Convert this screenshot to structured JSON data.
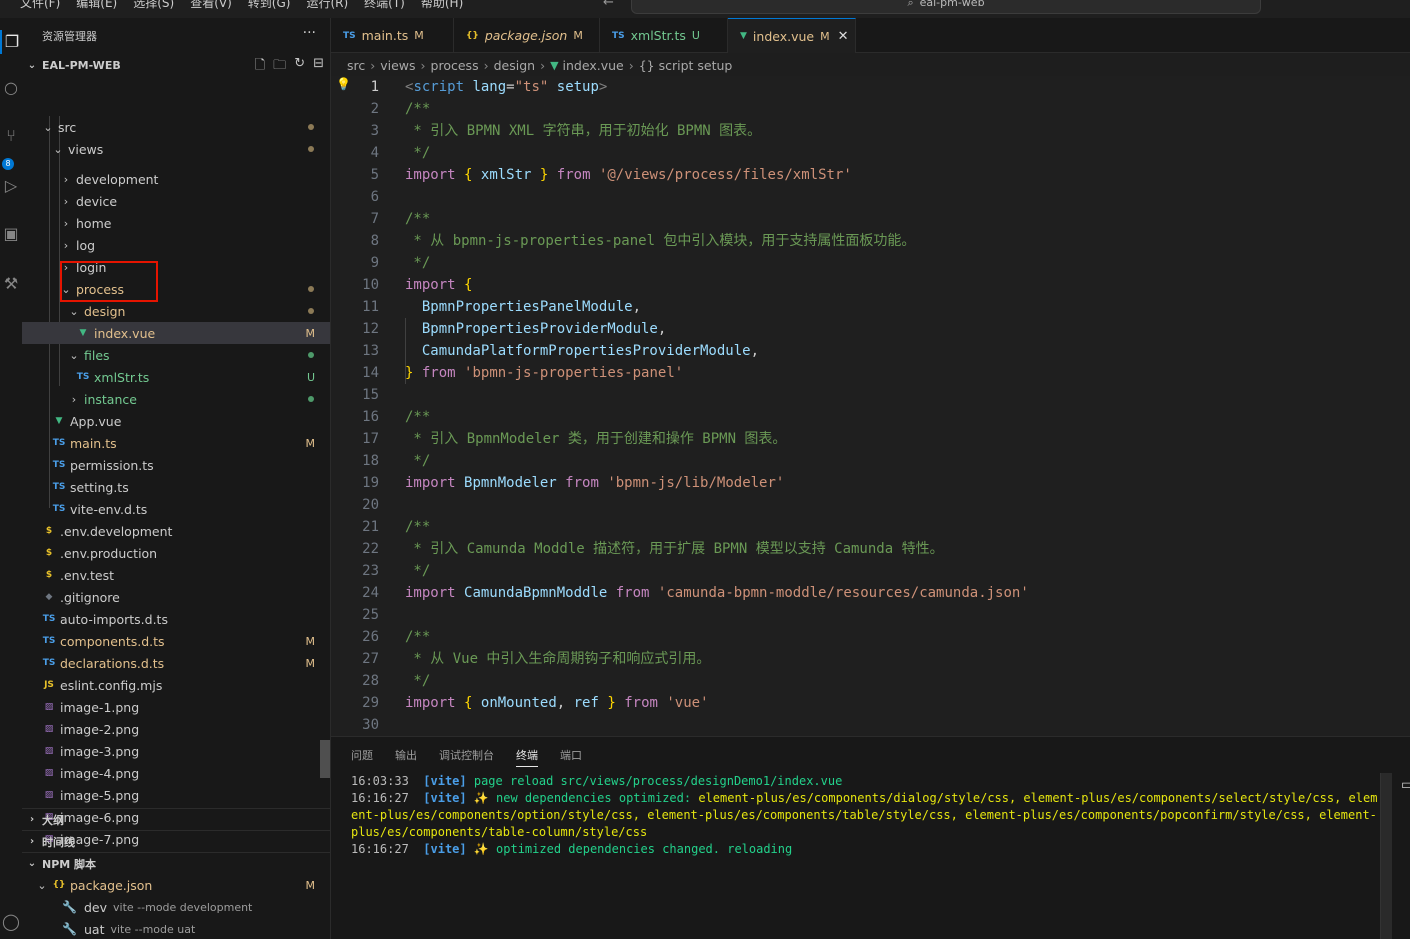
{
  "menu": [
    "文件(F)",
    "编辑(E)",
    "选择(S)",
    "查看(V)",
    "转到(G)",
    "运行(R)",
    "终端(T)",
    "帮助(H)"
  ],
  "nav_arrows": "← →",
  "command_center": "eal-pm-web",
  "activity_badge": "8",
  "explorer": {
    "title": "资源管理器",
    "more": "···",
    "project": "EAL-PM-WEB",
    "tools": [
      "new-file-icon",
      "new-folder-icon",
      "refresh-icon",
      "collapse-icon"
    ],
    "rows": [
      {
        "label": "src",
        "chev": "⌄",
        "indent": 20,
        "color": "#cccccc",
        "status": "dot"
      },
      {
        "label": "views",
        "chev": "⌄",
        "indent": 30,
        "color": "#cccccc",
        "status": "dot"
      },
      {
        "label": "development",
        "chev": "›",
        "indent": 38,
        "color": "#cccccc"
      },
      {
        "label": "device",
        "chev": "›",
        "indent": 38,
        "color": "#cccccc"
      },
      {
        "label": "home",
        "chev": "›",
        "indent": 38,
        "color": "#cccccc"
      },
      {
        "label": "log",
        "chev": "›",
        "indent": 38,
        "color": "#cccccc"
      },
      {
        "label": "login",
        "chev": "›",
        "indent": 38,
        "color": "#cccccc"
      },
      {
        "label": "process",
        "chev": "⌄",
        "indent": 38,
        "color": "#e2c08d",
        "status": "dot"
      },
      {
        "label": "design",
        "chev": "⌄",
        "indent": 46,
        "color": "#e2c08d",
        "status": "dot"
      },
      {
        "label": "index.vue",
        "icon": "vue",
        "indent": 54,
        "color": "#e2c08d",
        "status": "M",
        "selected": true
      },
      {
        "label": "files",
        "chev": "⌄",
        "indent": 46,
        "color": "#73c991",
        "status": "dotgreen"
      },
      {
        "label": "xmlStr.ts",
        "icon": "ts",
        "indent": 54,
        "color": "#73c991",
        "status": "U"
      },
      {
        "label": "instance",
        "chev": "›",
        "indent": 46,
        "color": "#73c991",
        "status": "dotgreen"
      },
      {
        "label": "App.vue",
        "icon": "vue",
        "indent": 30,
        "color": "#cccccc"
      },
      {
        "label": "main.ts",
        "icon": "ts",
        "indent": 30,
        "color": "#e2c08d",
        "status": "M"
      },
      {
        "label": "permission.ts",
        "icon": "ts",
        "indent": 30,
        "color": "#cccccc"
      },
      {
        "label": "setting.ts",
        "icon": "ts",
        "indent": 30,
        "color": "#cccccc"
      },
      {
        "label": "vite-env.d.ts",
        "icon": "ts",
        "indent": 30,
        "color": "#cccccc"
      },
      {
        "label": ".env.development",
        "icon": "env",
        "indent": 20,
        "color": "#cccccc"
      },
      {
        "label": ".env.production",
        "icon": "env",
        "indent": 20,
        "color": "#cccccc"
      },
      {
        "label": ".env.test",
        "icon": "env",
        "indent": 20,
        "color": "#cccccc"
      },
      {
        "label": ".gitignore",
        "icon": "git",
        "indent": 20,
        "color": "#cccccc"
      },
      {
        "label": "auto-imports.d.ts",
        "icon": "ts",
        "indent": 20,
        "color": "#cccccc"
      },
      {
        "label": "components.d.ts",
        "icon": "ts",
        "indent": 20,
        "color": "#e2c08d",
        "status": "M"
      },
      {
        "label": "declarations.d.ts",
        "icon": "ts",
        "indent": 20,
        "color": "#e2c08d",
        "status": "M"
      },
      {
        "label": "eslint.config.mjs",
        "icon": "js",
        "indent": 20,
        "color": "#cccccc"
      },
      {
        "label": "image-1.png",
        "icon": "img",
        "indent": 20,
        "color": "#cccccc"
      },
      {
        "label": "image-2.png",
        "icon": "img",
        "indent": 20,
        "color": "#cccccc"
      },
      {
        "label": "image-3.png",
        "icon": "img",
        "indent": 20,
        "color": "#cccccc"
      },
      {
        "label": "image-4.png",
        "icon": "img",
        "indent": 20,
        "color": "#cccccc"
      },
      {
        "label": "image-5.png",
        "icon": "img",
        "indent": 20,
        "color": "#cccccc"
      },
      {
        "label": "image-6.png",
        "icon": "img",
        "indent": 20,
        "color": "#cccccc"
      },
      {
        "label": "image-7.png",
        "icon": "img",
        "indent": 20,
        "color": "#cccccc"
      }
    ],
    "outline": "大纲",
    "timeline": "时间线",
    "npm_title": "NPM 脚本",
    "npm_package": "package.json",
    "npm_package_status": "M",
    "npm_scripts": [
      {
        "name": "dev",
        "cmd": "vite --mode development"
      },
      {
        "name": "uat",
        "cmd": "vite --mode uat"
      }
    ]
  },
  "tabs": [
    {
      "icon": "TS",
      "label": "main.ts",
      "status": "M",
      "color": "#e2c08d"
    },
    {
      "icon": "{}",
      "label": "package.json",
      "status": "M",
      "color": "#e2c08d",
      "italic": true
    },
    {
      "icon": "TS",
      "label": "xmlStr.ts",
      "status": "U",
      "color": "#73c991"
    },
    {
      "icon": "V",
      "label": "index.vue",
      "status": "M",
      "color": "#e2c08d",
      "active": true
    }
  ],
  "tab_close": "✕",
  "breadcrumb": [
    "src",
    "views",
    "process",
    "design",
    "index.vue",
    "{} script setup"
  ],
  "code_lines": [
    "<span class='pun'>&lt;</span><span class='tag'>script</span> <span class='attr'>lang</span>=<span class='str'>\"ts\"</span> <span class='attr'>setup</span><span class='pun'>&gt;</span>",
    "<span class='cm'>/**</span>",
    "<span class='cm'> * 引入 BPMN XML 字符串，用于初始化 BPMN 图表。</span>",
    "<span class='cm'> */</span>",
    "<span class='kw2'>import</span> <span class='br'>{</span> <span class='id'>xmlStr</span> <span class='br'>}</span> <span class='kw2'>from</span> <span class='str'>'@/views/process/files/xmlStr'</span>",
    "",
    "<span class='cm'>/**</span>",
    "<span class='cm'> * 从 bpmn-js-properties-panel 包中引入模块，用于支持属性面板功能。</span>",
    "<span class='cm'> */</span>",
    "<span class='kw2'>import</span> <span class='br'>{</span>",
    "  <span class='id'>BpmnPropertiesPanelModule</span>,",
    "  <span class='id'>BpmnPropertiesProviderModule</span>,",
    "  <span class='id'>CamundaPlatformPropertiesProviderModule</span>,",
    "<span class='br'>}</span> <span class='kw2'>from</span> <span class='str'>'bpmn-js-properties-panel'</span>",
    "",
    "<span class='cm'>/**</span>",
    "<span class='cm'> * 引入 BpmnModeler 类，用于创建和操作 BPMN 图表。</span>",
    "<span class='cm'> */</span>",
    "<span class='kw2'>import</span> <span class='id'>BpmnModeler</span> <span class='kw2'>from</span> <span class='str'>'bpmn-js/lib/Modeler'</span>",
    "",
    "<span class='cm'>/**</span>",
    "<span class='cm'> * 引入 Camunda Moddle 描述符，用于扩展 BPMN 模型以支持 Camunda 特性。</span>",
    "<span class='cm'> */</span>",
    "<span class='kw2'>import</span> <span class='id'>CamundaBpmnModdle</span> <span class='kw2'>from</span> <span class='str'>'camunda-bpmn-moddle/resources/camunda.json'</span>",
    "",
    "<span class='cm'>/**</span>",
    "<span class='cm'> * 从 Vue 中引入生命周期钩子和响应式引用。</span>",
    "<span class='cm'> */</span>",
    "<span class='kw2'>import</span> <span class='br'>{</span> <span class='id'>onMounted</span>, <span class='id'>ref</span> <span class='br'>}</span> <span class='kw2'>from</span> <span class='str'>'vue'</span>",
    ""
  ],
  "panel_tabs": [
    "问题",
    "输出",
    "调试控制台",
    "终端",
    "端口"
  ],
  "panel_active": "终端",
  "terminal": [
    {
      "time": "16:03:33",
      "tag": "[vite]",
      "text": "page reload src/views/process/designDemo1/index.vue",
      "cls": "green"
    },
    {
      "time": "16:16:27",
      "tag": "[vite]",
      "text": "✨ new dependencies optimized: ",
      "cls": "green",
      "extra": "element-plus/es/components/dialog/style/css, element-plus/es/components/select/style/css, element-plus/es/components/option/style/css, element-plus/es/components/table/style/css, element-plus/es/components/popconfirm/style/css, element-plus/es/components/table-column/style/css"
    },
    {
      "time": "16:16:27",
      "tag": "[vite]",
      "text": "✨ optimized dependencies changed. reloading",
      "cls": "green"
    }
  ]
}
